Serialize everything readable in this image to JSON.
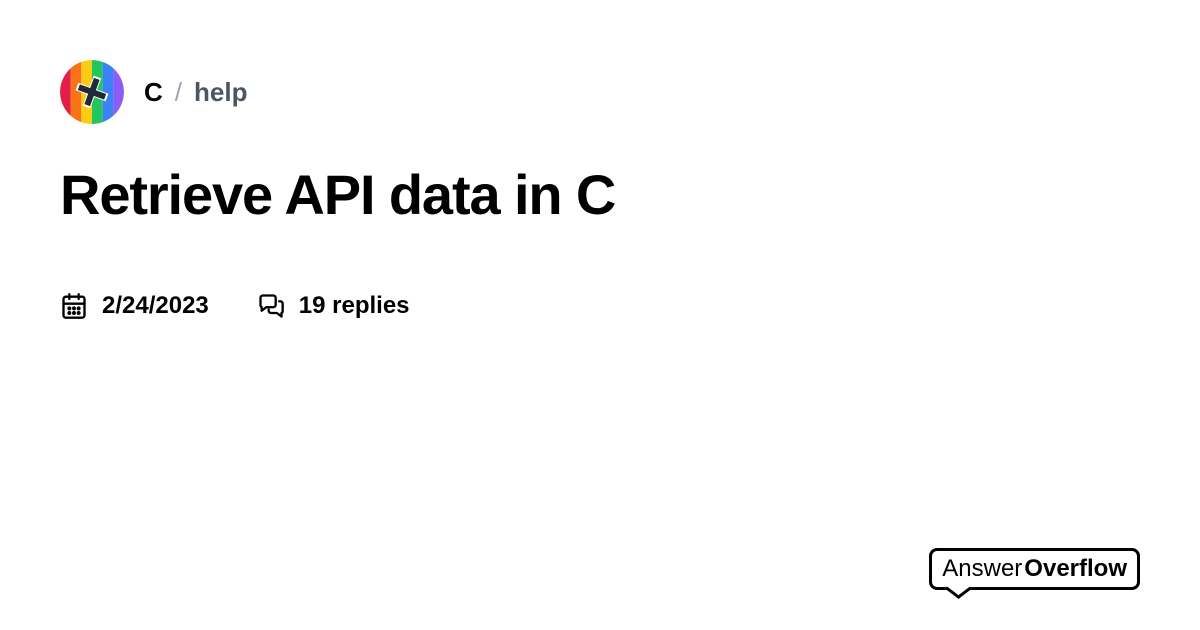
{
  "header": {
    "server_name": "C",
    "separator": "/",
    "channel_name": "help"
  },
  "post": {
    "title": "Retrieve API data in C",
    "date": "2/24/2023",
    "replies_label": "19 replies"
  },
  "brand": {
    "part1": "Answer",
    "part2": "Overflow"
  }
}
